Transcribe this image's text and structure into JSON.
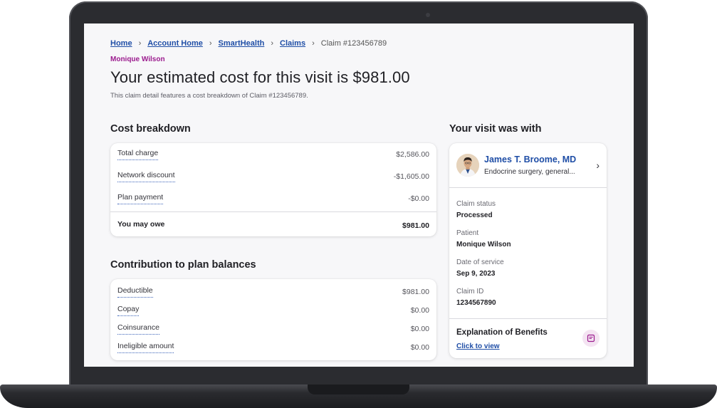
{
  "breadcrumb": {
    "items": [
      "Home",
      "Account Home",
      "SmartHealth",
      "Claims"
    ],
    "separator": "›",
    "current": "Claim #123456789"
  },
  "member_name": "Monique Wilson",
  "page_title": "Your estimated cost for this visit is $981.00",
  "page_subtitle": "This claim detail features a cost breakdown of Claim #123456789.",
  "cost_breakdown": {
    "title": "Cost breakdown",
    "rows": [
      {
        "label": "Total charge",
        "value": "$2,586.00"
      },
      {
        "label": "Network discount",
        "value": "-$1,605.00"
      },
      {
        "label": "Plan payment",
        "value": "-$0.00"
      }
    ],
    "total": {
      "label": "You may owe",
      "value": "$981.00"
    }
  },
  "plan_balances": {
    "title": "Contribution to plan balances",
    "rows": [
      {
        "label": "Deductible",
        "value": "$981.00"
      },
      {
        "label": "Copay",
        "value": "$0.00"
      },
      {
        "label": "Coinsurance",
        "value": "$0.00"
      },
      {
        "label": "Ineligible amount",
        "value": "$0.00"
      }
    ]
  },
  "visit": {
    "title": "Your visit was with",
    "doctor_name": "James T. Broome, MD",
    "doctor_specialty": "Endocrine surgery, general...",
    "fields": [
      {
        "label": "Claim status",
        "value": "Processed"
      },
      {
        "label": "Patient",
        "value": "Monique Wilson"
      },
      {
        "label": "Date of service",
        "value": "Sep 9, 2023"
      },
      {
        "label": "Claim ID",
        "value": "1234567890"
      }
    ],
    "eob_title": "Explanation of Benefits",
    "eob_link": "Click to view"
  },
  "icons": {
    "breadcrumb_separator": "chevron-right-icon",
    "doctor_row_arrow": "chevron-right-icon",
    "eob": "document-icon",
    "avatar": "doctor-avatar"
  },
  "colors": {
    "link": "#1f4ea6",
    "member_name": "#9b1b8e",
    "eob_icon_bg": "#f4e4f2",
    "eob_icon": "#9b1b8e"
  }
}
